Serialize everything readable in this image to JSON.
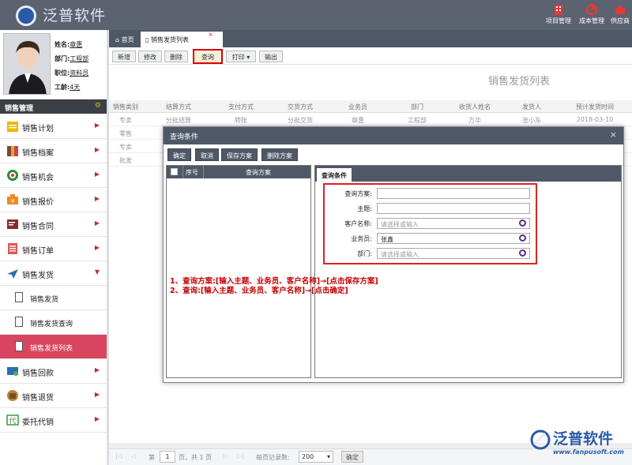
{
  "app": {
    "logo_text": "泛普软件"
  },
  "topnav": [
    {
      "label": "项目管理"
    },
    {
      "label": "成本管理"
    },
    {
      "label": "供应商"
    }
  ],
  "profile": {
    "name_label": "姓名:",
    "name": "章惠",
    "dept_label": "部门:",
    "dept": "工程部",
    "title_label": "职位:",
    "title": "资料员",
    "tenure_label": "工龄:",
    "tenure": "4天"
  },
  "menu": {
    "header": "销售管理",
    "items": [
      {
        "label": "销售计划"
      },
      {
        "label": "销售档案"
      },
      {
        "label": "销售机会"
      },
      {
        "label": "销售报价"
      },
      {
        "label": "销售合同"
      },
      {
        "label": "销售订单"
      },
      {
        "label": "销售发货"
      }
    ],
    "subitems": [
      {
        "label": "销售发货"
      },
      {
        "label": "销售发货查询"
      },
      {
        "label": "销售发货列表"
      }
    ],
    "items2": [
      {
        "label": "销售回款"
      },
      {
        "label": "销售退货"
      },
      {
        "label": "委托代销"
      }
    ]
  },
  "tabs": {
    "home": "首页",
    "current": "销售发货列表",
    "close": "×"
  },
  "toolbar": {
    "add": "新增",
    "edit": "修改",
    "delete": "删除",
    "query": "查询",
    "print": "打印",
    "export": "输出"
  },
  "list": {
    "title": "销售发货列表",
    "columns": [
      "销售类别",
      "结算方式",
      "支付方式",
      "交货方式",
      "业务员",
      "部门",
      "收货人姓名",
      "发货人",
      "预计发货时间"
    ],
    "rows": [
      [
        "专卖",
        "分批结算",
        "转账",
        "分批交货",
        "章惠",
        "工程部",
        "方华",
        "张小东",
        "2018-03-10"
      ],
      [
        "零售",
        "",
        "",
        "",
        "",
        "",
        "",
        "",
        ""
      ],
      [
        "专卖",
        "",
        "",
        "",
        "",
        "",
        "",
        "",
        ""
      ],
      [
        "批发",
        "",
        "",
        "",
        "",
        "",
        "",
        "",
        ""
      ]
    ]
  },
  "dialog": {
    "title": "查询条件",
    "close": "×",
    "buttons": {
      "ok": "确定",
      "cancel": "取消",
      "save": "保存方案",
      "delete": "删除方案"
    },
    "left_cols": {
      "seq": "序号",
      "scheme": "查询方案"
    },
    "tab": "查询条件",
    "fields": [
      {
        "label": "查询方案:",
        "value": "",
        "placeholder": ""
      },
      {
        "label": "主题:",
        "value": "",
        "placeholder": ""
      },
      {
        "label": "客户名称:",
        "value": "",
        "placeholder": "请选择或输入"
      },
      {
        "label": "业务员:",
        "value": "张鑫",
        "placeholder": ""
      },
      {
        "label": "部门:",
        "value": "",
        "placeholder": "请选择或输入"
      }
    ],
    "annotation": [
      "1、查询方案:[输入主题、业务员、客户名称]→[点击保存方案]",
      "2、查询:[输入主题、业务员、客户名称]→[点击确定]"
    ]
  },
  "pager": {
    "page_label": "第",
    "page": "1",
    "of_label": "页，共 1 页",
    "per_label": "每页记录数:",
    "per": "200",
    "ok": "确定"
  },
  "watermark": {
    "text": "泛普软件",
    "url": "www.fanpusoft.com"
  },
  "colors": {
    "accent": "#d9455f",
    "dark": "#4f5866",
    "red": "#d00000"
  }
}
